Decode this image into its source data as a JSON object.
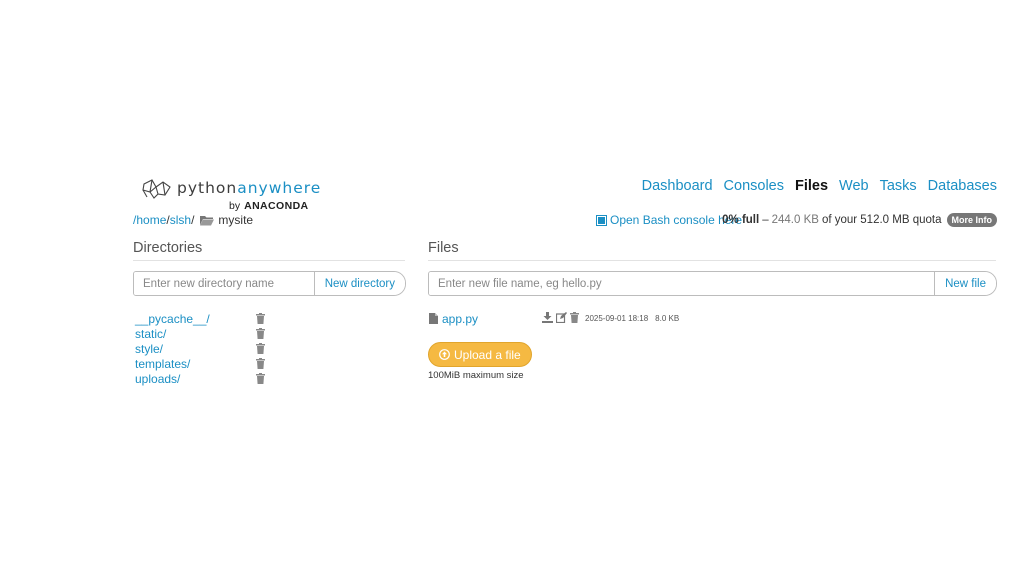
{
  "logo": {
    "word_a": "python",
    "word_b": "anywhere",
    "by": "by",
    "anaconda": "ANACONDA"
  },
  "nav": [
    {
      "label": "Dashboard",
      "active": false
    },
    {
      "label": "Consoles",
      "active": false
    },
    {
      "label": "Files",
      "active": true
    },
    {
      "label": "Web",
      "active": false
    },
    {
      "label": "Tasks",
      "active": false
    },
    {
      "label": "Databases",
      "active": false
    }
  ],
  "breadcrumb": {
    "root_sep": "/",
    "home": "home",
    "sep1": "/",
    "user": "slsh",
    "sep2": "/",
    "current": "mysite"
  },
  "console_link": "Open Bash console here",
  "quota": {
    "full": "0% full",
    "dash": "–",
    "used": "244.0 KB",
    "of": "of your 512.0 MB quota",
    "more": "More Info"
  },
  "directories": {
    "title": "Directories",
    "placeholder": "Enter new directory name",
    "button": "New directory",
    "items": [
      "__pycache__/",
      "static/",
      "style/",
      "templates/",
      "uploads/"
    ]
  },
  "files": {
    "title": "Files",
    "placeholder": "Enter new file name, eg hello.py",
    "button": "New file",
    "items": [
      {
        "name": "app.py",
        "modified": "2025-09-01 18:18",
        "size": "8.0 KB"
      }
    ],
    "upload_label": "Upload a file",
    "upload_note": "100MiB maximum size"
  },
  "colors": {
    "link": "#1b8fc4",
    "upload": "#f5b942",
    "badge": "#777777"
  }
}
